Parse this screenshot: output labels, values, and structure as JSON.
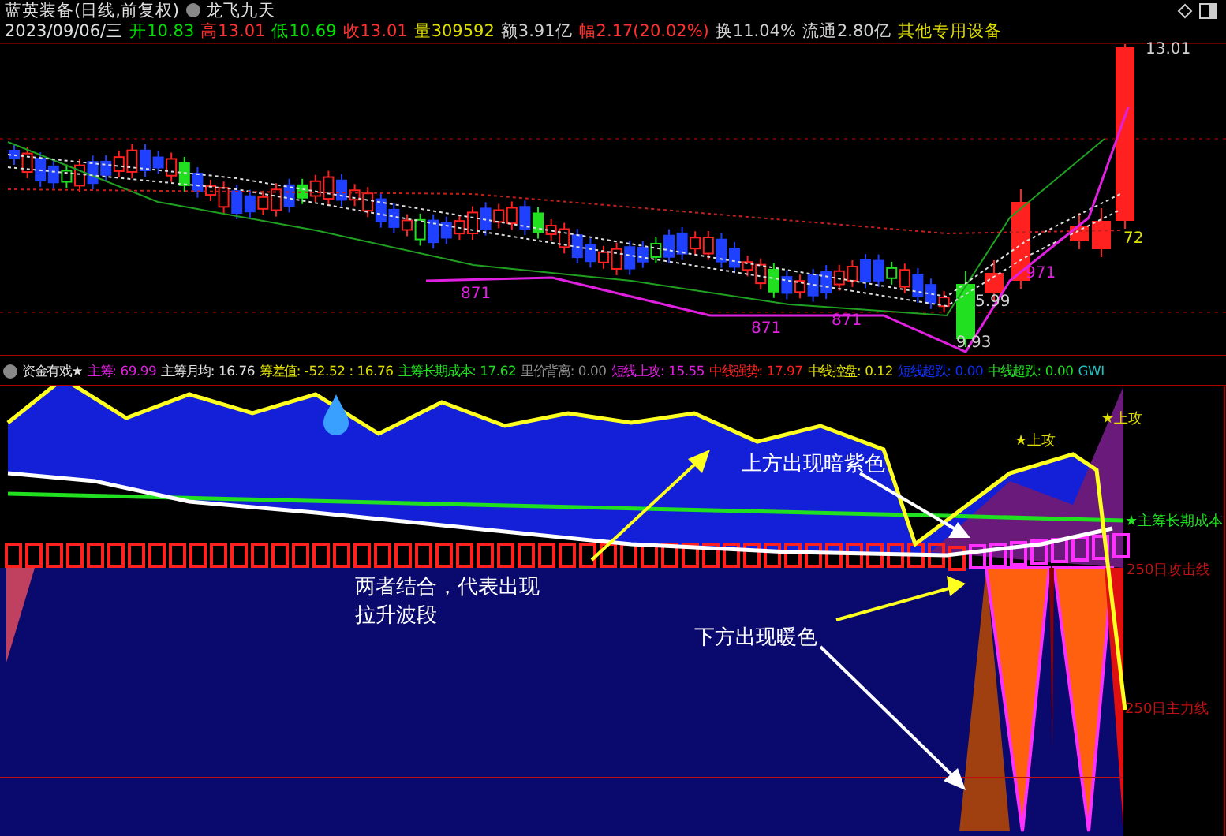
{
  "header": {
    "title": "蓝英装备(日线,前复权)",
    "formula": "龙飞九天",
    "date": "2023/09/06/三",
    "quote": [
      {
        "label": "开",
        "value": "10.83",
        "color": "#00e000"
      },
      {
        "label": "高",
        "value": "13.01",
        "color": "#ff3030"
      },
      {
        "label": "低",
        "value": "10.69",
        "color": "#00e000"
      },
      {
        "label": "收",
        "value": "13.01",
        "color": "#ff3030"
      },
      {
        "label": "量",
        "value": "309592",
        "color": "#e0e000"
      },
      {
        "label": "额",
        "value": "3.91亿",
        "color": "#d0d0d0"
      },
      {
        "label": "幅",
        "value": "2.17(20.02%)",
        "color": "#ff3030"
      },
      {
        "label": "换",
        "value": "11.04%",
        "color": "#d0d0d0"
      },
      {
        "label": "流通",
        "value": "2.80亿",
        "color": "#d0d0d0"
      }
    ],
    "sector": "其他专用设备"
  },
  "price_chart": {
    "labels": [
      {
        "text": "13.01",
        "kind": "price"
      },
      {
        "text": "72",
        "kind": "signal"
      },
      {
        "text": "5.99",
        "kind": "price"
      },
      {
        "text": "871",
        "kind": "line"
      },
      {
        "text": "871",
        "kind": "line"
      },
      {
        "text": "871",
        "kind": "line"
      },
      {
        "text": "971",
        "kind": "line"
      },
      {
        "text": "9.93",
        "kind": "price"
      }
    ]
  },
  "indicator": {
    "name": "资金有戏★",
    "items": [
      {
        "label": "主筹:",
        "value": "69.99",
        "color": "#e020e0"
      },
      {
        "label": "主筹月均:",
        "value": "16.76",
        "color": "#e0e0e0"
      },
      {
        "label": "筹差值:",
        "value": "-52.52 : 16.76",
        "color": "#e0e000"
      },
      {
        "label": "主筹长期成本:",
        "value": "17.62",
        "color": "#20e020"
      },
      {
        "label": "里价背离:",
        "value": "0.00",
        "color": "#909090"
      },
      {
        "label": "短线上攻:",
        "value": "15.55",
        "color": "#e020e0"
      },
      {
        "label": "中线强势:",
        "value": "17.97",
        "color": "#ff2020"
      },
      {
        "label": "中线控盘:",
        "value": "0.12",
        "color": "#e0e000"
      },
      {
        "label": "短线超跌:",
        "value": "0.00",
        "color": "#1030ff"
      },
      {
        "label": "中线超跌:",
        "value": "0.00",
        "color": "#20e020"
      }
    ],
    "tail": "GWI"
  },
  "lower_chart": {
    "labels": [
      {
        "text": "★上攻",
        "kind": "signal"
      },
      {
        "text": "★上攻",
        "kind": "signal"
      },
      {
        "text": "★主筹长期成本",
        "kind": "cost"
      },
      {
        "text": "250日攻击线",
        "kind": "line"
      },
      {
        "text": "250日主力线",
        "kind": "line"
      }
    ],
    "annotations": [
      {
        "text": "上方出现暗紫色"
      },
      {
        "text": "两者结合，代表出现"
      },
      {
        "text": "拉升波段"
      },
      {
        "text": "下方出现暖色"
      }
    ]
  }
}
